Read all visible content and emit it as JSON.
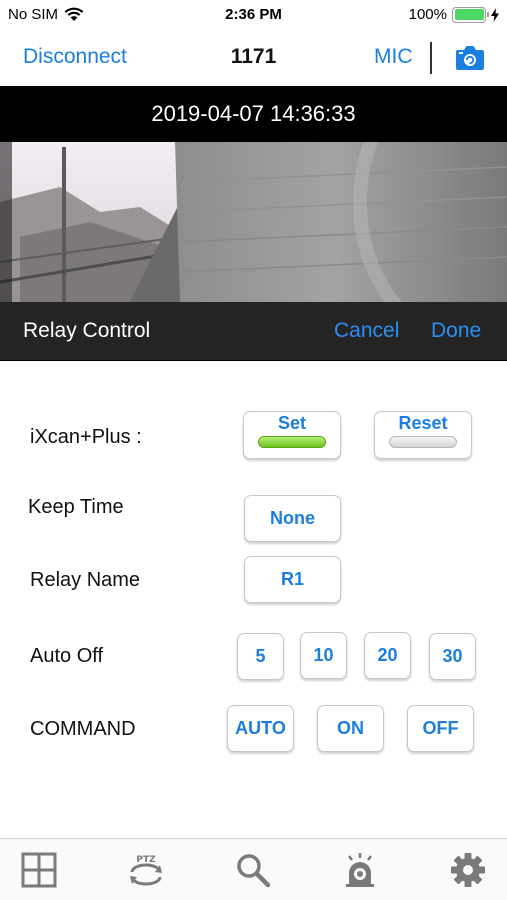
{
  "status_bar": {
    "carrier": "No SIM",
    "time": "2:36 PM",
    "battery_percent": "100%",
    "battery_level": 1.0,
    "icons": [
      "wifi-icon",
      "battery-icon",
      "charging-icon"
    ]
  },
  "nav": {
    "disconnect_label": "Disconnect",
    "title": "1171",
    "mic_label": "MIC",
    "camera_icon": "camera-icon"
  },
  "video": {
    "timestamp": "2019-04-07 14:36:33"
  },
  "relay_bar": {
    "title": "Relay Control",
    "cancel_label": "Cancel",
    "done_label": "Done"
  },
  "form": {
    "device_label": "iXcan+Plus :",
    "set_label": "Set",
    "reset_label": "Reset",
    "set_state": "on",
    "reset_state": "off",
    "keep_time_label": "Keep Time",
    "keep_time_value": "None",
    "relay_name_label": "Relay Name",
    "relay_name_value": "R1",
    "auto_off_label": "Auto Off",
    "auto_off_options": [
      "5",
      "10",
      "20",
      "30"
    ],
    "command_label": "COMMAND",
    "command_options": [
      "AUTO",
      "ON",
      "OFF"
    ]
  },
  "tab_bar": {
    "tabs": [
      "grid-icon",
      "ptz-icon",
      "search-icon",
      "alarm-icon",
      "gear-icon"
    ],
    "ptz_text": "PTZ"
  },
  "colors": {
    "accent": "#1a7fe0",
    "indicator_on": "#6cc51d",
    "relay_bar": "#282828"
  }
}
